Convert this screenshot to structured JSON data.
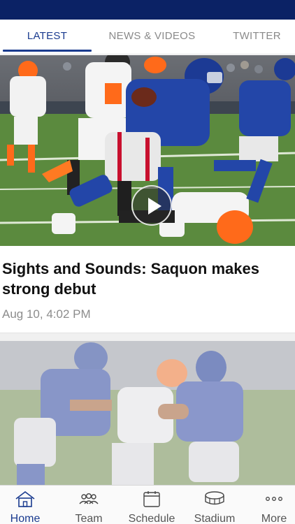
{
  "header": {
    "bar_color": "#0b2265"
  },
  "tabs": [
    {
      "label": "LATEST",
      "active": true
    },
    {
      "label": "NEWS & VIDEOS",
      "active": false
    },
    {
      "label": "TWITTER",
      "active": false
    }
  ],
  "featured": {
    "image_alt": "Giants running back carrying the ball against Cleveland Browns defenders",
    "has_video": true,
    "play_icon": "play-icon",
    "headline": "Sights and Sounds: Saquon makes strong debut",
    "timestamp": "Aug 10, 4:02 PM"
  },
  "second_card": {
    "image_alt": "Giants players in blue jerseys against Browns players"
  },
  "bottom_nav": [
    {
      "label": "Home",
      "icon": "home-icon",
      "active": true
    },
    {
      "label": "Team",
      "icon": "team-icon",
      "active": false
    },
    {
      "label": "Schedule",
      "icon": "calendar-icon",
      "active": false
    },
    {
      "label": "Stadium",
      "icon": "stadium-icon",
      "active": false
    },
    {
      "label": "More",
      "icon": "more-icon",
      "active": false
    }
  ],
  "colors": {
    "accent": "#1a3b8f",
    "giants_blue": "#0b2265",
    "browns_orange": "#ff5a14"
  }
}
